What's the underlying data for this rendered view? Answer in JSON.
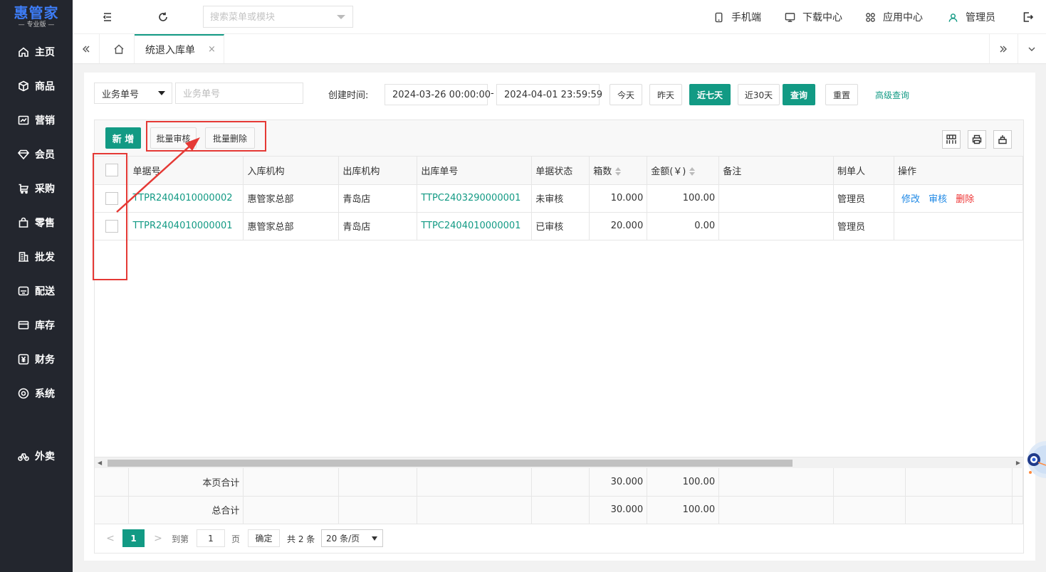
{
  "app": {
    "logo_main": "惠管家",
    "logo_sub": "— 专业版 —"
  },
  "sidebar": {
    "items": [
      {
        "label": "主页",
        "icon": "home-icon"
      },
      {
        "label": "商品",
        "icon": "box-icon"
      },
      {
        "label": "营销",
        "icon": "chart-icon"
      },
      {
        "label": "会员",
        "icon": "diamond-icon"
      },
      {
        "label": "采购",
        "icon": "cart-icon"
      },
      {
        "label": "零售",
        "icon": "bag-icon"
      },
      {
        "label": "批发",
        "icon": "building-icon"
      },
      {
        "label": "配送",
        "icon": "truck-icon"
      },
      {
        "label": "库存",
        "icon": "inventory-icon"
      },
      {
        "label": "财务",
        "icon": "yen-icon"
      },
      {
        "label": "系统",
        "icon": "gear-icon"
      },
      {
        "label": "外卖",
        "icon": "bike-icon"
      }
    ]
  },
  "header": {
    "search_placeholder": "搜索菜单或模块",
    "links": [
      {
        "label": "手机端",
        "icon": "phone-icon"
      },
      {
        "label": "下载中心",
        "icon": "monitor-icon"
      },
      {
        "label": "应用中心",
        "icon": "apps-icon"
      },
      {
        "label": "管理员",
        "icon": "user-icon"
      }
    ]
  },
  "tabs": {
    "active": "统退入库单",
    "close": "×"
  },
  "filters": {
    "type_select": "业务单号",
    "order_placeholder": "业务单号",
    "created_label": "创建时间:",
    "start_time": "2024-03-26 00:00:00",
    "separator": "-",
    "end_time": "2024-04-01 23:59:59",
    "today": "今天",
    "yesterday": "昨天",
    "last7": "近七天",
    "last30": "近30天",
    "query": "查询",
    "reset": "重置",
    "advanced": "高级查询"
  },
  "toolbar": {
    "add": "新 增",
    "batch_audit": "批量审核",
    "batch_delete": "批量删除"
  },
  "table": {
    "columns": [
      "单据号",
      "入库机构",
      "出库机构",
      "出库单号",
      "单据状态",
      "箱数",
      "金额(￥)",
      "备注",
      "制单人",
      "操作"
    ],
    "rows": [
      {
        "doc_no": "TTPR2404010000002",
        "in_org": "惠管家总部",
        "out_org": "青岛店",
        "out_no": "TTPC2403290000001",
        "status": "未审核",
        "boxes": "10.000",
        "amount": "100.00",
        "remark": "",
        "creator": "管理员",
        "actions": [
          "修改",
          "审核",
          "删除"
        ]
      },
      {
        "doc_no": "TTPR2404010000001",
        "in_org": "惠管家总部",
        "out_org": "青岛店",
        "out_no": "TTPC2404010000001",
        "status": "已审核",
        "boxes": "20.000",
        "amount": "0.00",
        "remark": "",
        "creator": "管理员",
        "actions": []
      }
    ],
    "page_total_label": "本页合计",
    "page_total_boxes": "30.000",
    "page_total_amount": "100.00",
    "grand_total_label": "总合计",
    "grand_total_boxes": "30.000",
    "grand_total_amount": "100.00"
  },
  "pager": {
    "current": "1",
    "goto_label": "到第",
    "goto_value": "1",
    "page_unit": "页",
    "confirm": "确定",
    "total": "共 2 条",
    "page_size": "20 条/页"
  },
  "colors": {
    "primary": "#129a84",
    "sidebar_bg": "#23262e",
    "annotation": "#e53935",
    "link_blue": "#1e88e5",
    "danger": "#ee3333"
  }
}
